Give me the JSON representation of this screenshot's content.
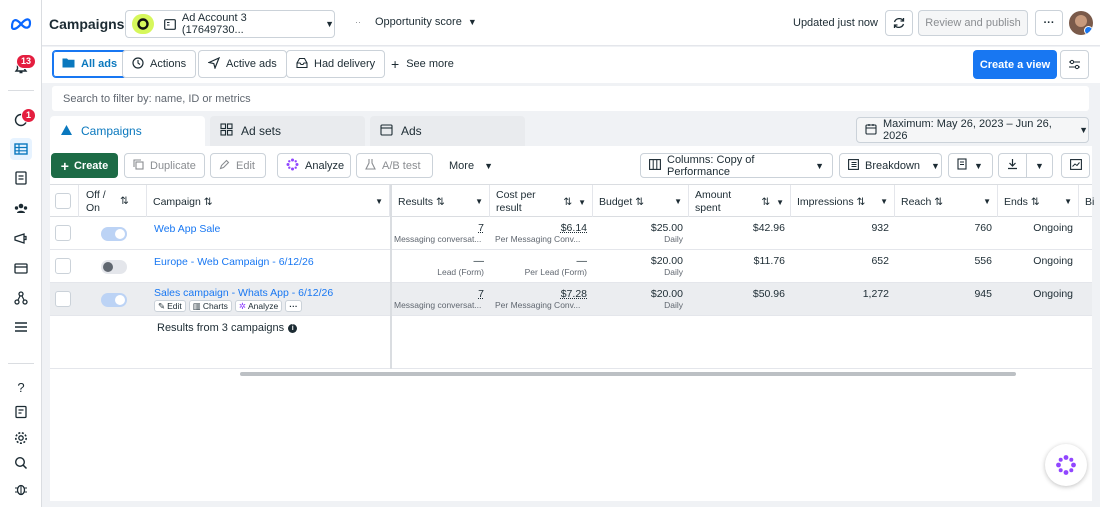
{
  "header": {
    "title": "Campaigns",
    "ad_account": "Ad Account 3 (17649730...",
    "opportunity": "Opportunity score",
    "updated": "Updated just now",
    "review_publish": "Review and publish",
    "more": "···"
  },
  "rail": {
    "notifications_badge": "13",
    "alerts_badge": "1"
  },
  "filters": {
    "chips": [
      "All ads",
      "Actions",
      "Active ads",
      "Had delivery"
    ],
    "see_more": "See more",
    "create_view": "Create a view"
  },
  "search": {
    "placeholder": "Search to filter by: name, ID or metrics"
  },
  "tabs": [
    "Campaigns",
    "Ad sets",
    "Ads"
  ],
  "date_range": "Maximum: May 26, 2023 – Jun 26, 2026",
  "toolbar": {
    "create": "Create",
    "duplicate": "Duplicate",
    "edit": "Edit",
    "analyze": "Analyze",
    "ab_test": "A/B test",
    "more": "More",
    "columns": "Columns: Copy of Performance",
    "breakdown": "Breakdown"
  },
  "columns": {
    "offon": "Off / On",
    "campaign": "Campaign",
    "results": "Results",
    "cost1": "Cost per",
    "cost2": "result",
    "budget": "Budget",
    "amount1": "Amount",
    "amount2": "spent",
    "impressions": "Impressions",
    "reach": "Reach",
    "ends": "Ends",
    "bid": "Bi"
  },
  "rows": [
    {
      "name": "Web App Sale",
      "results": "7",
      "results_sub": "Messaging conversat...",
      "cost": "$6.14",
      "cost_sub": "Per Messaging Conv...",
      "budget": "$25.00",
      "budget_sub": "Daily",
      "spent": "$42.96",
      "impressions": "932",
      "reach": "760",
      "ends": "Ongoing",
      "on": true
    },
    {
      "name": "Europe - Web Campaign - 6/12/26",
      "results": "—",
      "results_sub": "Lead (Form)",
      "cost": "—",
      "cost_sub": "Per Lead (Form)",
      "budget": "$20.00",
      "budget_sub": "Daily",
      "spent": "$11.76",
      "impressions": "652",
      "reach": "556",
      "ends": "Ongoing",
      "on": false
    },
    {
      "name": "Sales campaign - Whats App - 6/12/26",
      "results": "7",
      "results_sub": "Messaging conversat...",
      "cost": "$7.28",
      "cost_sub": "Per Messaging Conv...",
      "budget": "$20.00",
      "budget_sub": "Daily",
      "spent": "$50.96",
      "impressions": "1,272",
      "reach": "945",
      "ends": "Ongoing",
      "on": true
    }
  ],
  "row_actions": {
    "edit": "Edit",
    "charts": "Charts",
    "analyze": "Analyze"
  },
  "summary": "Results from 3 campaigns"
}
